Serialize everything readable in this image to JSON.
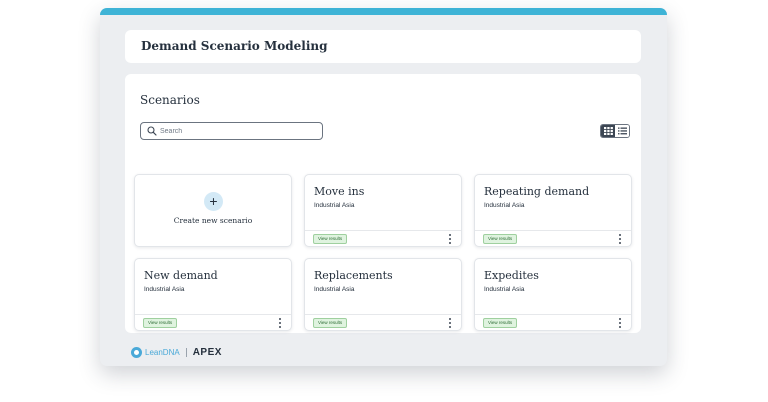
{
  "header": {
    "title": "Demand Scenario Modeling"
  },
  "scenarios": {
    "title": "Scenarios",
    "search": {
      "placeholder": "Search",
      "value": ""
    },
    "create": {
      "label": "Create new scenario",
      "icon": "plus-icon"
    },
    "cards": [
      {
        "title": "Move ins",
        "subtitle": "Industrial Asia",
        "badge": "View results"
      },
      {
        "title": "Repeating demand",
        "subtitle": "Industrial Asia",
        "badge": "View results"
      },
      {
        "title": "New demand",
        "subtitle": "Industrial Asia",
        "badge": "View results"
      },
      {
        "title": "Replacements",
        "subtitle": "Industrial Asia",
        "badge": "View results"
      },
      {
        "title": "Expedites",
        "subtitle": "Industrial Asia",
        "badge": "View results"
      }
    ],
    "view_toggle": {
      "active": "grid",
      "options": [
        "grid-icon",
        "list-icon"
      ]
    }
  },
  "footer": {
    "brand": "LeanDNA",
    "product": "APEX"
  },
  "colors": {
    "accent_bar": "#3eb3d6",
    "badge_bg": "#dff3df",
    "badge_text": "#2c6b34",
    "brand_blue": "#4aa9d8",
    "text_dark": "#25303d"
  }
}
